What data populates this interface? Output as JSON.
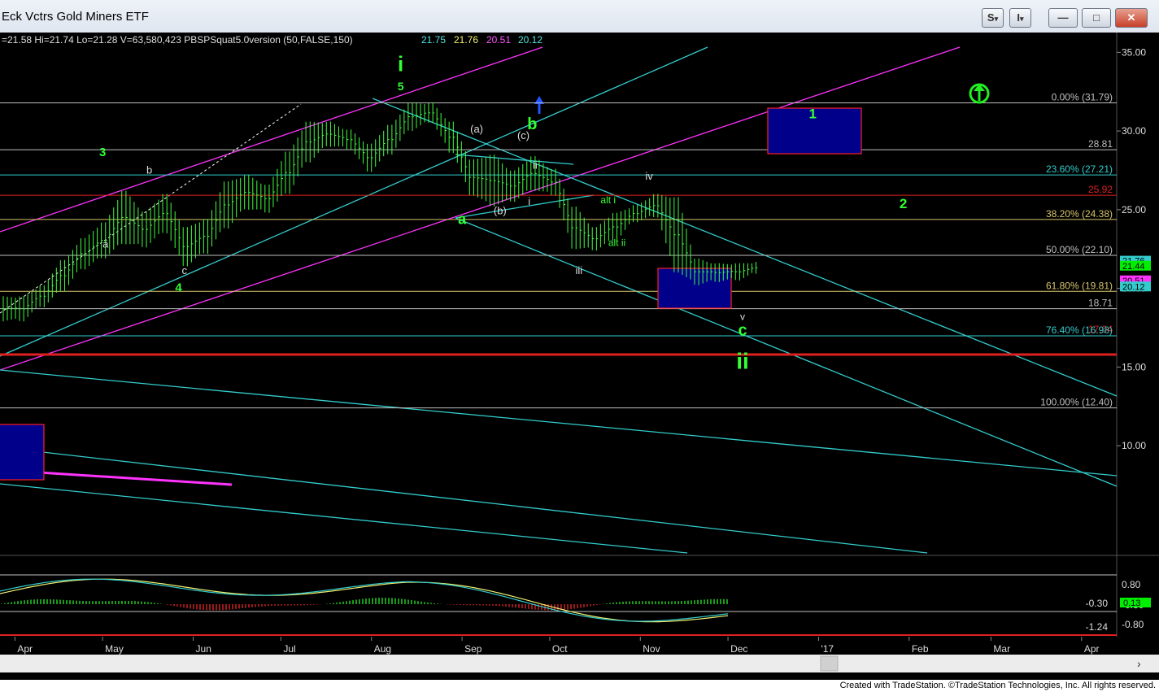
{
  "window": {
    "title": "Eck Vctrs Gold Miners ETF",
    "buttons": [
      {
        "name": "s-menu-button",
        "glyph": "S",
        "caret": "▾"
      },
      {
        "name": "i-menu-button",
        "glyph": "I",
        "caret": "▾"
      },
      {
        "name": "minimize-button",
        "glyph": "—"
      },
      {
        "name": "maximize-button",
        "glyph": "□"
      },
      {
        "name": "close-button",
        "glyph": "✕"
      }
    ]
  },
  "header": {
    "quote": "=21.58  Hi=21.74  Lo=21.28  V=63,580,423  PBSPSquat5.0version (50,FALSE,150)",
    "values": [
      {
        "text": "21.75",
        "color": "#55e0e0"
      },
      {
        "text": "21.76",
        "color": "#f0f070"
      },
      {
        "text": "20.51",
        "color": "#ff55ff"
      },
      {
        "text": "20.12",
        "color": "#55e0e0"
      }
    ]
  },
  "colors": {
    "background": "#000000",
    "bars": "#40ff40",
    "cyan": "#33cccc",
    "magenta": "#ff33ff",
    "fib_line": "#bfbfbf",
    "red_line": "#e02020",
    "box_fill": "#00008b",
    "box_border": "#ff2020",
    "label_green": "#33ff33",
    "label_white": "#dddddd"
  },
  "chart_data": {
    "type": "bar",
    "title": "Eck Vctrs Gold Miners ETF",
    "x_labels": [
      "Apr",
      "May",
      "Jun",
      "Jul",
      "Aug",
      "Sep",
      "Oct",
      "Nov",
      "Dec",
      "'17",
      "Feb",
      "Mar",
      "Apr"
    ],
    "y_ticks": [
      "35.00",
      "30.00",
      "25.00",
      "20.00",
      "15.00",
      "10.00"
    ],
    "ylim": [
      5.5,
      36.0
    ],
    "ohlc": [
      {
        "date": "2016-03-28",
        "low": 17.9,
        "high": 19.5
      },
      {
        "date": "2016-04-04",
        "low": 18.8,
        "high": 20.2
      },
      {
        "date": "2016-04-11",
        "low": 19.8,
        "high": 21.8
      },
      {
        "date": "2016-04-18",
        "low": 21.2,
        "high": 23.2
      },
      {
        "date": "2016-04-25",
        "low": 21.9,
        "high": 24.2
      },
      {
        "date": "2016-05-02",
        "low": 22.8,
        "high": 26.2
      },
      {
        "date": "2016-05-09",
        "low": 22.6,
        "high": 24.9
      },
      {
        "date": "2016-05-16",
        "low": 23.5,
        "high": 26.0
      },
      {
        "date": "2016-05-23",
        "low": 21.4,
        "high": 23.9
      },
      {
        "date": "2016-05-30",
        "low": 22.2,
        "high": 24.4
      },
      {
        "date": "2016-06-06",
        "low": 23.8,
        "high": 26.8
      },
      {
        "date": "2016-06-13",
        "low": 25.0,
        "high": 27.2
      },
      {
        "date": "2016-06-20",
        "low": 24.8,
        "high": 26.6
      },
      {
        "date": "2016-06-27",
        "low": 26.0,
        "high": 28.7
      },
      {
        "date": "2016-07-04",
        "low": 28.0,
        "high": 30.6
      },
      {
        "date": "2016-07-11",
        "low": 29.0,
        "high": 30.6
      },
      {
        "date": "2016-07-18",
        "low": 28.8,
        "high": 30.1
      },
      {
        "date": "2016-07-25",
        "low": 27.4,
        "high": 29.2
      },
      {
        "date": "2016-08-01",
        "low": 28.5,
        "high": 30.4
      },
      {
        "date": "2016-08-08",
        "low": 30.0,
        "high": 31.8
      },
      {
        "date": "2016-08-15",
        "low": 30.5,
        "high": 31.8
      },
      {
        "date": "2016-08-22",
        "low": 28.6,
        "high": 30.6
      },
      {
        "date": "2016-08-29",
        "low": 25.9,
        "high": 28.2
      },
      {
        "date": "2016-09-05",
        "low": 25.2,
        "high": 28.5
      },
      {
        "date": "2016-09-12",
        "low": 25.5,
        "high": 27.5
      },
      {
        "date": "2016-09-19",
        "low": 26.2,
        "high": 28.4
      },
      {
        "date": "2016-09-26",
        "low": 25.9,
        "high": 27.6
      },
      {
        "date": "2016-10-03",
        "low": 22.5,
        "high": 25.2
      },
      {
        "date": "2016-10-10",
        "low": 22.4,
        "high": 23.9
      },
      {
        "date": "2016-10-17",
        "low": 23.0,
        "high": 24.8
      },
      {
        "date": "2016-10-24",
        "low": 24.2,
        "high": 25.3
      },
      {
        "date": "2016-10-31",
        "low": 24.5,
        "high": 26.0
      },
      {
        "date": "2016-11-07",
        "low": 21.0,
        "high": 25.8
      },
      {
        "date": "2016-11-14",
        "low": 20.2,
        "high": 21.9
      },
      {
        "date": "2016-11-21",
        "low": 20.4,
        "high": 21.6
      },
      {
        "date": "2016-11-28",
        "low": 20.5,
        "high": 21.6
      },
      {
        "date": "2016-12-05",
        "low": 20.9,
        "high": 21.7
      }
    ],
    "fib_levels": [
      {
        "label": "0.00% (31.79)",
        "value": 31.79,
        "color": "#bfbfbf"
      },
      {
        "label": "28.81",
        "value": 28.81,
        "color": "#bfbfbf"
      },
      {
        "label": "23.60% (27.21)",
        "value": 27.21,
        "color": "#33cccc"
      },
      {
        "label": "25.92",
        "value": 25.92,
        "color": "#e02020"
      },
      {
        "label": "38.20% (24.38)",
        "value": 24.38,
        "color": "#d7c56b"
      },
      {
        "label": "50.00% (22.10)",
        "value": 22.1,
        "color": "#bfbfbf"
      },
      {
        "label": "61.80% (19.81)",
        "value": 19.81,
        "color": "#d7c56b"
      },
      {
        "label": "18.71",
        "value": 18.71,
        "color": "#bfbfbf"
      },
      {
        "label": "17.04",
        "value": 17.04,
        "color": "#e02020"
      },
      {
        "label": "76.40% (16.98)",
        "value": 16.98,
        "color": "#33cccc"
      },
      {
        "label": "100.00% (12.40)",
        "value": 12.4,
        "color": "#bfbfbf"
      }
    ],
    "price_tags": [
      {
        "text": "21.76",
        "value": 21.76,
        "bg": "#33cccc",
        "fg": "#000000"
      },
      {
        "text": "21.44",
        "value": 21.44,
        "bg": "#00ee00",
        "fg": "#000000"
      },
      {
        "text": "20.51",
        "value": 20.51,
        "bg": "#ff33ff",
        "fg": "#000000"
      },
      {
        "text": "20.12",
        "value": 20.12,
        "bg": "#33cccc",
        "fg": "#000000"
      }
    ],
    "annotations": [
      {
        "text": "i",
        "date": "2016-08-11",
        "value": 33.8,
        "color": "#33ff33",
        "size": 26,
        "weight": "bold"
      },
      {
        "text": "5",
        "date": "2016-08-11",
        "value": 32.6,
        "color": "#33ff33",
        "size": 14,
        "weight": "bold"
      },
      {
        "text": "3",
        "date": "2016-05-01",
        "value": 28.4,
        "color": "#33ff33",
        "size": 15,
        "weight": "bold"
      },
      {
        "text": "4",
        "date": "2016-05-27",
        "value": 19.8,
        "color": "#33ff33",
        "size": 15,
        "weight": "bold"
      },
      {
        "text": "a",
        "date": "2016-05-02",
        "value": 22.6,
        "color": "#dddddd",
        "size": 13,
        "weight": "normal"
      },
      {
        "text": "b",
        "date": "2016-05-17",
        "value": 27.3,
        "color": "#dddddd",
        "size": 13,
        "weight": "normal"
      },
      {
        "text": "c",
        "date": "2016-05-29",
        "value": 20.9,
        "color": "#dddddd",
        "size": 13,
        "weight": "normal"
      },
      {
        "text": "(a)",
        "date": "2016-09-06",
        "value": 29.9,
        "color": "#dddddd",
        "size": 13,
        "weight": "normal"
      },
      {
        "text": "(b)",
        "date": "2016-09-14",
        "value": 24.7,
        "color": "#dddddd",
        "size": 13,
        "weight": "normal"
      },
      {
        "text": "(c)",
        "date": "2016-09-22",
        "value": 29.5,
        "color": "#dddddd",
        "size": 13,
        "weight": "normal"
      },
      {
        "text": "b",
        "date": "2016-09-25",
        "value": 30.1,
        "color": "#33ff33",
        "size": 20,
        "weight": "bold"
      },
      {
        "text": "a",
        "date": "2016-09-01",
        "value": 24.1,
        "color": "#33ff33",
        "size": 18,
        "weight": "bold"
      },
      {
        "text": "i",
        "date": "2016-09-24",
        "value": 25.3,
        "color": "#dddddd",
        "size": 13,
        "weight": "normal"
      },
      {
        "text": "ii",
        "date": "2016-09-26",
        "value": 27.6,
        "color": "#dddddd",
        "size": 13,
        "weight": "normal"
      },
      {
        "text": "iii",
        "date": "2016-10-11",
        "value": 20.9,
        "color": "#dddddd",
        "size": 13,
        "weight": "normal"
      },
      {
        "text": "alt i",
        "date": "2016-10-21",
        "value": 25.4,
        "color": "#33ff33",
        "size": 12,
        "weight": "normal"
      },
      {
        "text": "alt ii",
        "date": "2016-10-24",
        "value": 22.7,
        "color": "#33ff33",
        "size": 12,
        "weight": "normal"
      },
      {
        "text": "iv",
        "date": "2016-11-04",
        "value": 26.9,
        "color": "#dddddd",
        "size": 13,
        "weight": "normal"
      },
      {
        "text": "v",
        "date": "2016-12-06",
        "value": 18.0,
        "color": "#dddddd",
        "size": 12,
        "weight": "normal"
      },
      {
        "text": "c",
        "date": "2016-12-06",
        "value": 17.0,
        "color": "#33ff33",
        "size": 20,
        "weight": "bold"
      },
      {
        "text": "ii",
        "date": "2016-12-06",
        "value": 14.9,
        "color": "#33ff33",
        "size": 28,
        "weight": "bold"
      },
      {
        "text": "1",
        "date": "2016-12-30",
        "value": 30.8,
        "color": "#33ff33",
        "size": 17,
        "weight": "bold"
      },
      {
        "text": "2",
        "date": "2017-01-30",
        "value": 25.1,
        "color": "#33ff33",
        "size": 17,
        "weight": "bold"
      }
    ],
    "oscillator": {
      "ticks": [
        "0.80",
        "-0.30",
        "-0.80"
      ],
      "value_labels": [
        "-0.30",
        "-1.24"
      ],
      "tag": {
        "text": "0.13",
        "bg": "#00ee00",
        "fg": "#000000"
      }
    }
  }
}
